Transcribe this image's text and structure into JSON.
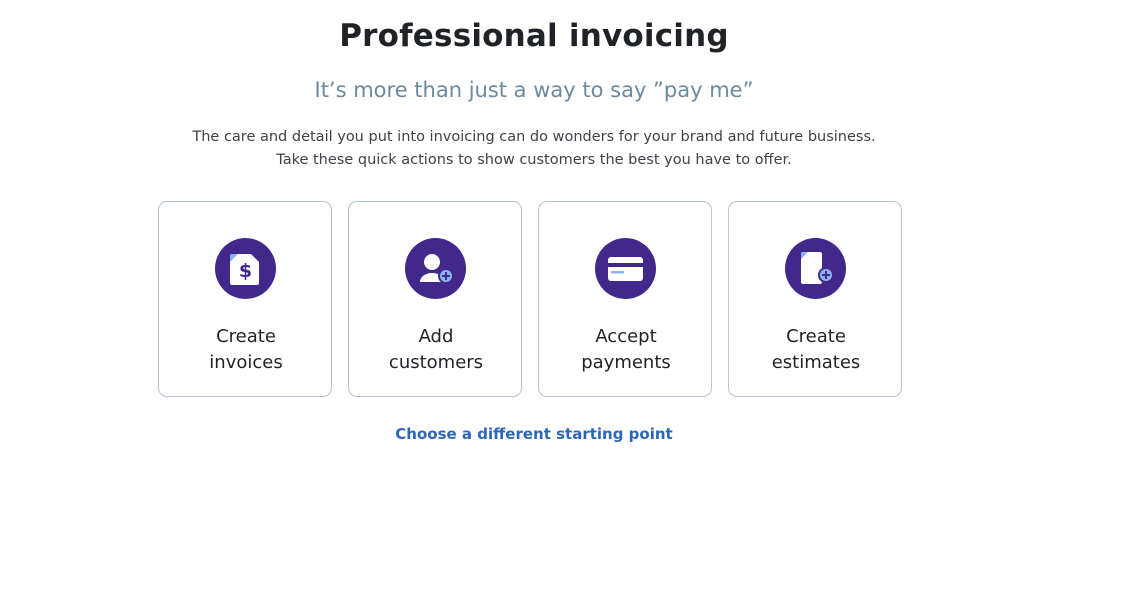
{
  "header": {
    "title": "Professional invoicing",
    "subtitle": "It’s more than just a way to say ”pay me”",
    "description_line1": "The care and detail you put into invoicing can do wonders for your brand and future business.",
    "description_line2": "Take these quick actions to show customers the best you have to offer."
  },
  "cards": [
    {
      "line1": "Create",
      "line2": "invoices",
      "icon": "invoice-dollar-icon"
    },
    {
      "line1": "Add",
      "line2": "customers",
      "icon": "add-customer-icon"
    },
    {
      "line1": "Accept",
      "line2": "payments",
      "icon": "credit-card-icon"
    },
    {
      "line1": "Create",
      "line2": "estimates",
      "icon": "add-document-icon"
    }
  ],
  "footer": {
    "link_label": "Choose a different starting point"
  },
  "colors": {
    "icon_bg": "#42288a",
    "accent_light": "#8ab4f0",
    "link": "#2c66b8",
    "subtitle": "#6b8aa0"
  }
}
